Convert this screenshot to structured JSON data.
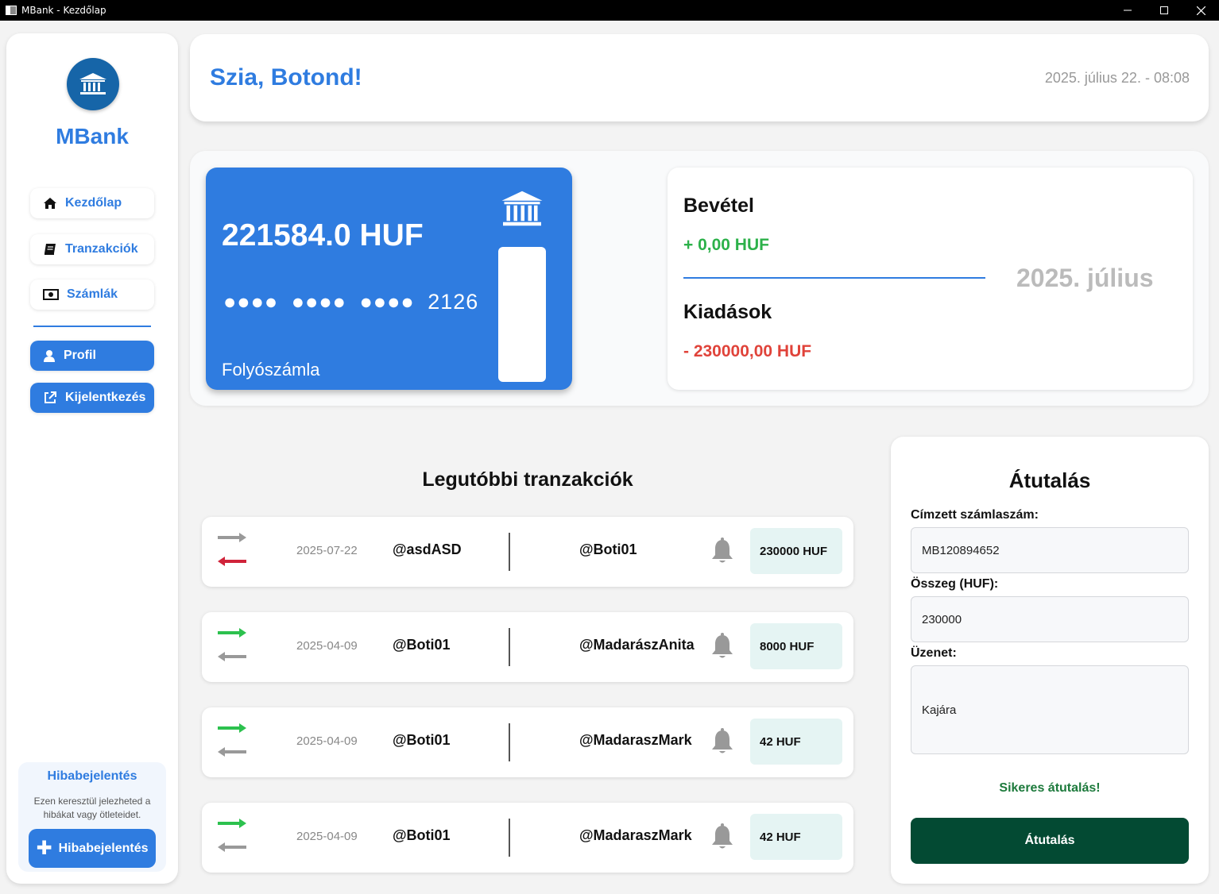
{
  "window": {
    "title": "MBank - Kezdőlap"
  },
  "sidebar": {
    "brand": "MBank",
    "nav": [
      {
        "label": "Kezdőlap",
        "icon": "home-icon"
      },
      {
        "label": "Tranzakciók",
        "icon": "book-icon"
      },
      {
        "label": "Számlák",
        "icon": "money-icon"
      }
    ],
    "profile_label": "Profil",
    "logout_label": "Kijelentkezés",
    "bug_report": {
      "title": "Hibabejelentés",
      "description": "Ezen keresztül jelezheted a hibákat vagy ötleteidet.",
      "button_label": "Hibabejelentés"
    }
  },
  "header": {
    "greeting": "Szia, Botond!",
    "datetime": "2025. július 22. - 08:08"
  },
  "card": {
    "balance": "221584.0 HUF",
    "number": "●●●● ●●●● ●●●● 2126",
    "type": "Folyószámla"
  },
  "summary": {
    "income_label": "Bevétel",
    "income_value": "+ 0,00 HUF",
    "expense_label": "Kiadások",
    "expense_value": "- 230000,00 HUF",
    "month": "2025. július"
  },
  "transactions": {
    "title": "Legutóbbi tranzakciók",
    "items": [
      {
        "direction": "incoming",
        "date": "2025-07-22",
        "from": "@asdASD",
        "to": "@Boti01",
        "amount": "230000 HUF"
      },
      {
        "direction": "outgoing",
        "date": "2025-04-09",
        "from": "@Boti01",
        "to": "@MadarászAnita",
        "amount": "8000 HUF"
      },
      {
        "direction": "outgoing",
        "date": "2025-04-09",
        "from": "@Boti01",
        "to": "@MadaraszMark",
        "amount": "42 HUF"
      },
      {
        "direction": "outgoing",
        "date": "2025-04-09",
        "from": "@Boti01",
        "to": "@MadaraszMark",
        "amount": "42 HUF"
      }
    ]
  },
  "transfer": {
    "title": "Átutalás",
    "account_label": "Címzett számlaszám:",
    "account_value": "MB120894652",
    "amount_label": "Összeg (HUF):",
    "amount_value": "230000",
    "message_label": "Üzenet:",
    "message_value": "Kajára",
    "status": "Sikeres átutalás!",
    "button_label": "Átutalás"
  },
  "colors": {
    "accent": "#2f7ce0",
    "income": "#2cb14a",
    "expense": "#e0433a",
    "transfer_button": "#034a33",
    "arrow_in": "#d0233a",
    "arrow_out": "#2cc14e",
    "arrow_idle": "#999999"
  }
}
